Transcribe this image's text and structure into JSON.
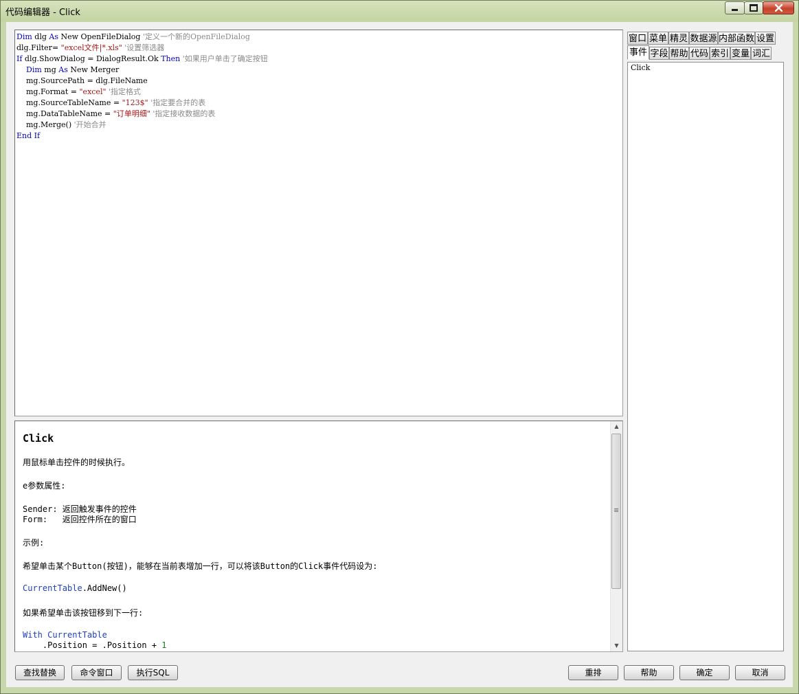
{
  "window": {
    "title": "代码编辑器 - Click"
  },
  "editor": {
    "lines": [
      [
        {
          "t": "Dim",
          "c": "kw"
        },
        {
          "t": " dlg "
        },
        {
          "t": "As",
          "c": "kw"
        },
        {
          "t": " New OpenFileDialog "
        },
        {
          "t": "'定义一个新的OpenFileDialog",
          "c": "cmt"
        }
      ],
      [
        {
          "t": "dlg.Filter= "
        },
        {
          "t": "\"excel文件|*.xls\"",
          "c": "str"
        },
        {
          "t": " "
        },
        {
          "t": "'设置筛选器",
          "c": "cmt"
        }
      ],
      [
        {
          "t": "If",
          "c": "kw"
        },
        {
          "t": " dlg.ShowDialog = DialogResult.Ok "
        },
        {
          "t": "Then",
          "c": "kw"
        },
        {
          "t": " "
        },
        {
          "t": "'如果用户单击了确定按钮",
          "c": "cmt"
        }
      ],
      [
        {
          "t": "    "
        },
        {
          "t": "Dim",
          "c": "kw"
        },
        {
          "t": " mg "
        },
        {
          "t": "As",
          "c": "kw"
        },
        {
          "t": " New Merger"
        }
      ],
      [
        {
          "t": "    mg.SourcePath = dlg.FileName"
        }
      ],
      [
        {
          "t": "    mg.Format = "
        },
        {
          "t": "\"excel\"",
          "c": "str"
        },
        {
          "t": " "
        },
        {
          "t": "'指定格式",
          "c": "cmt"
        }
      ],
      [
        {
          "t": "    mg.SourceTableName = "
        },
        {
          "t": "\"123$\"",
          "c": "str"
        },
        {
          "t": " "
        },
        {
          "t": "'指定要合并的表",
          "c": "cmt"
        }
      ],
      [
        {
          "t": "    mg.DataTableName = "
        },
        {
          "t": "\"订单明细\"",
          "c": "str"
        },
        {
          "t": " "
        },
        {
          "t": "'指定接收数据的表",
          "c": "cmt"
        }
      ],
      [
        {
          "t": "    mg.Merge() "
        },
        {
          "t": "'开始合并",
          "c": "cmt"
        }
      ],
      [
        {
          "t": "End",
          "c": "kw"
        },
        {
          "t": " "
        },
        {
          "t": "If",
          "c": "kw"
        }
      ]
    ]
  },
  "help": {
    "title": "Click",
    "desc": "用鼠标单击控件的时候执行。",
    "params_heading": "e参数属性:",
    "sender": "Sender: 返回触发事件的控件",
    "form": "Form:   返回控件所在的窗口",
    "example_heading": "示例:",
    "example_desc": "希望单击某个Button(按钮)，能够在当前表增加一行，可以将该Button的Click事件代码设为:",
    "code1_obj": "CurrentTable",
    "code1_rest": ".AddNew()",
    "example2_desc": "如果希望单击该按钮移到下一行:",
    "code2_kw": "With",
    "code2_obj": " CurrentTable",
    "code3_text": "    .Position = .Position + ",
    "code3_num": "1"
  },
  "tabs_row1": [
    "窗口",
    "菜单",
    "精灵",
    "数据源",
    "内部函数",
    "设置"
  ],
  "tabs_row2": [
    "事件",
    "字段",
    "帮助",
    "代码",
    "索引",
    "变量",
    "词汇"
  ],
  "events": [
    "Click"
  ],
  "buttons": {
    "find_replace": "查找替换",
    "command_window": "命令窗口",
    "exec_sql": "执行SQL",
    "rearrange": "重排",
    "help": "帮助",
    "ok": "确定",
    "cancel": "取消"
  },
  "colors": {
    "keyword": "#0000c8",
    "string": "#a31515",
    "comment": "#8a8a8a",
    "frame": "#c9d7ac"
  }
}
